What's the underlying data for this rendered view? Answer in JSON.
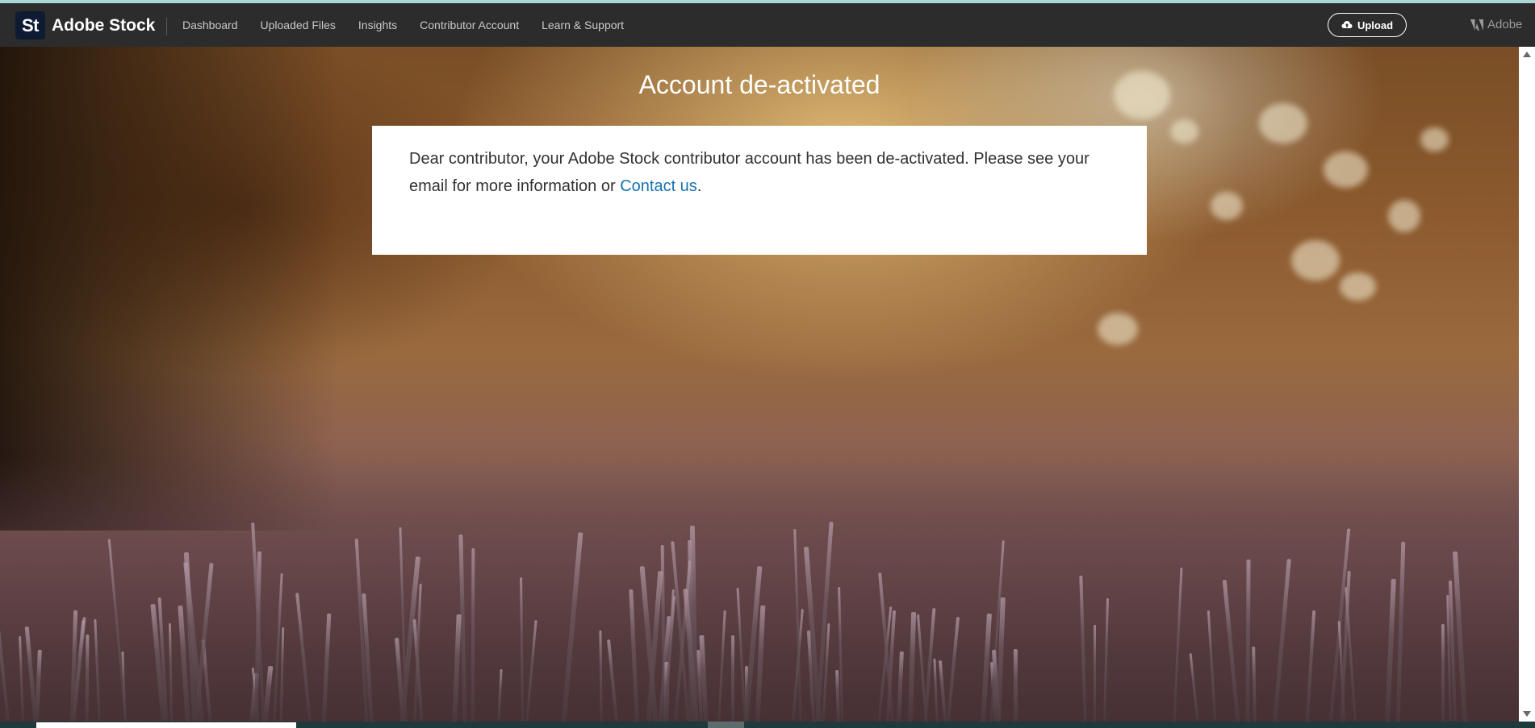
{
  "header": {
    "logo_text": "St",
    "brand": "Adobe Stock",
    "nav": [
      {
        "label": "Dashboard"
      },
      {
        "label": "Uploaded Files"
      },
      {
        "label": "Insights"
      },
      {
        "label": "Contributor Account"
      },
      {
        "label": "Learn & Support"
      }
    ],
    "upload_label": "Upload",
    "adobe_label": "Adobe"
  },
  "main": {
    "title": "Account de-activated",
    "message_prefix": "Dear contributor, your Adobe Stock contributor account has been de-activated. Please see your email for more information or ",
    "contact_link": "Contact us",
    "message_suffix": "."
  },
  "icons": {
    "upload": "cloud-upload-icon",
    "adobe": "adobe-logo-icon"
  },
  "colors": {
    "nav_bg": "#2c2c2c",
    "logo_bg": "#0f1b33",
    "link": "#1473b0",
    "text": "#323232"
  }
}
